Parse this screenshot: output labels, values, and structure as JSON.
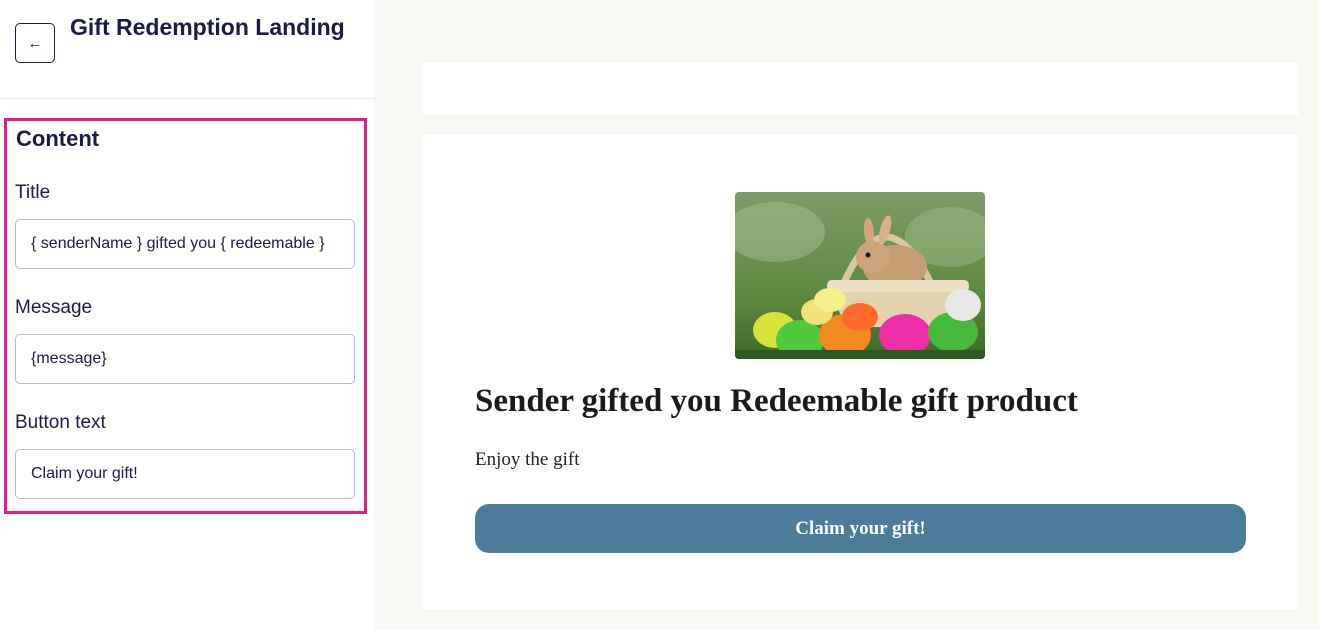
{
  "header": {
    "back_icon": "arrow-left-icon",
    "title": "Gift Redemption Landing"
  },
  "content": {
    "heading": "Content",
    "fields": [
      {
        "label": "Title",
        "value": "{ senderName } gifted you { redeemable }"
      },
      {
        "label": "Message",
        "value": "{message}"
      },
      {
        "label": "Button text",
        "value": "Claim your gift!"
      }
    ]
  },
  "colors": {
    "accent_highlight": "#e41e87",
    "button": "#4a7c99",
    "text_primary": "#1b1c44"
  },
  "preview": {
    "image": "easter-bunny-basket-eggs-image",
    "title": "Sender gifted you Redeemable gift product",
    "message": "Enjoy the gift",
    "button_label": "Claim your gift!"
  }
}
